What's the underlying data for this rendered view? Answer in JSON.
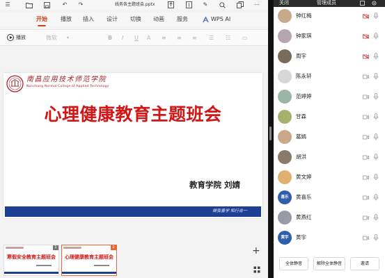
{
  "app": {
    "file_title": "线务各主题班会.pptx",
    "menu_tabs": [
      "开始",
      "播放",
      "插入",
      "设计",
      "切换",
      "动画",
      "服务"
    ],
    "ai_label": "WPS AI",
    "toolbar": {
      "play_label": "播放",
      "font_name": "微软",
      "font_size_label": "A"
    }
  },
  "slide": {
    "school_name_cn": "南昌应用技术师范学院",
    "school_name_en": "Nanchang Normal College of Applied Technology",
    "title": "心理健康教育主题班会",
    "presenter": "教育学院    刘婧",
    "motto": "继我善学 知行合一"
  },
  "thumbnails": [
    {
      "number": "1",
      "title": "寒假安全教育主题班会"
    },
    {
      "number": "2",
      "title": "心理健康教育主题班会"
    }
  ],
  "panel": {
    "close_label": "关闭",
    "title": "管理成员",
    "members": [
      {
        "name": "钟红梅",
        "avatar_text": "",
        "avatar_color": "#c8a98a",
        "cam_off": true
      },
      {
        "name": "钟家琪",
        "avatar_text": "",
        "avatar_color": "#b7a6b0",
        "cam_off": true
      },
      {
        "name": "周宇",
        "avatar_text": "",
        "avatar_color": "#7a6a5a",
        "cam_off": true
      },
      {
        "name": "陈永轩",
        "avatar_text": "",
        "avatar_color": "#d7d7d7",
        "cam_off": false
      },
      {
        "name": "范婷婷",
        "avatar_text": "",
        "avatar_color": "#9ab7a6",
        "cam_off": false
      },
      {
        "name": "甘森",
        "avatar_text": "",
        "avatar_color": "#a6b16e",
        "cam_off": false
      },
      {
        "name": "葛嫣",
        "avatar_text": "",
        "avatar_color": "#c9a98a",
        "cam_off": false
      },
      {
        "name": "胡洪",
        "avatar_text": "",
        "avatar_color": "#8a7a6a",
        "cam_off": false
      },
      {
        "name": "黄文婷",
        "avatar_text": "",
        "avatar_color": "#e0b070",
        "cam_off": false
      },
      {
        "name": "黄喜乐",
        "avatar_text": "喜乐",
        "avatar_color": "#2f5fa8",
        "cam_off": false
      },
      {
        "name": "黄燕红",
        "avatar_text": "",
        "avatar_color": "#9a9aa6",
        "cam_off": false
      },
      {
        "name": "黄宇",
        "avatar_text": "黄宇",
        "avatar_color": "#2f5fa8",
        "cam_off": false
      }
    ],
    "footer_buttons": [
      "全体静音",
      "解除全体静音",
      "邀请"
    ]
  },
  "colors": {
    "accent": "#d0421b",
    "title_red": "#d21616",
    "footer_blue": "#1c3f93",
    "cam_off_red": "#d03a3a"
  }
}
